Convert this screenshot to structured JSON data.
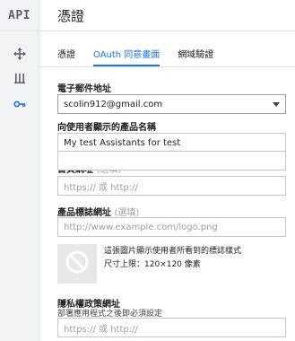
{
  "app": {
    "logo_text": "API",
    "title": "憑證"
  },
  "rail": {
    "items": [
      {
        "icon": "move-icon"
      },
      {
        "icon": "library-icon"
      },
      {
        "icon": "key-icon",
        "active": true
      }
    ]
  },
  "tabs": [
    {
      "label": "憑證"
    },
    {
      "label": "OAuth 同意畫面",
      "active": true
    },
    {
      "label": "網域驗證"
    }
  ],
  "form": {
    "email": {
      "label": "電子郵件地址",
      "value": "scolin912@gmail.com"
    },
    "product_name": {
      "label": "向使用者顯示的產品名稱",
      "value": "My test Assistants for test"
    },
    "homepage": {
      "label": "首頁網址",
      "optional": "(選填)",
      "placeholder": "https:// 或 http://"
    },
    "logo_url": {
      "label": "產品標誌網址",
      "optional": "(選填)",
      "placeholder": "http://www.example.com/logo.png"
    },
    "logo_preview": {
      "desc_line1": "這張圖片顯示使用者所看到的標誌樣式",
      "desc_line2": "尺寸上限：120×120 像素"
    },
    "privacy": {
      "label": "隱私權政策網址",
      "hint": "部署應用程式之後即必須設定",
      "placeholder": "https:// 或 http://"
    }
  },
  "colors": {
    "accent": "#1a73e8",
    "rail_bg": "#f1f3f4"
  }
}
